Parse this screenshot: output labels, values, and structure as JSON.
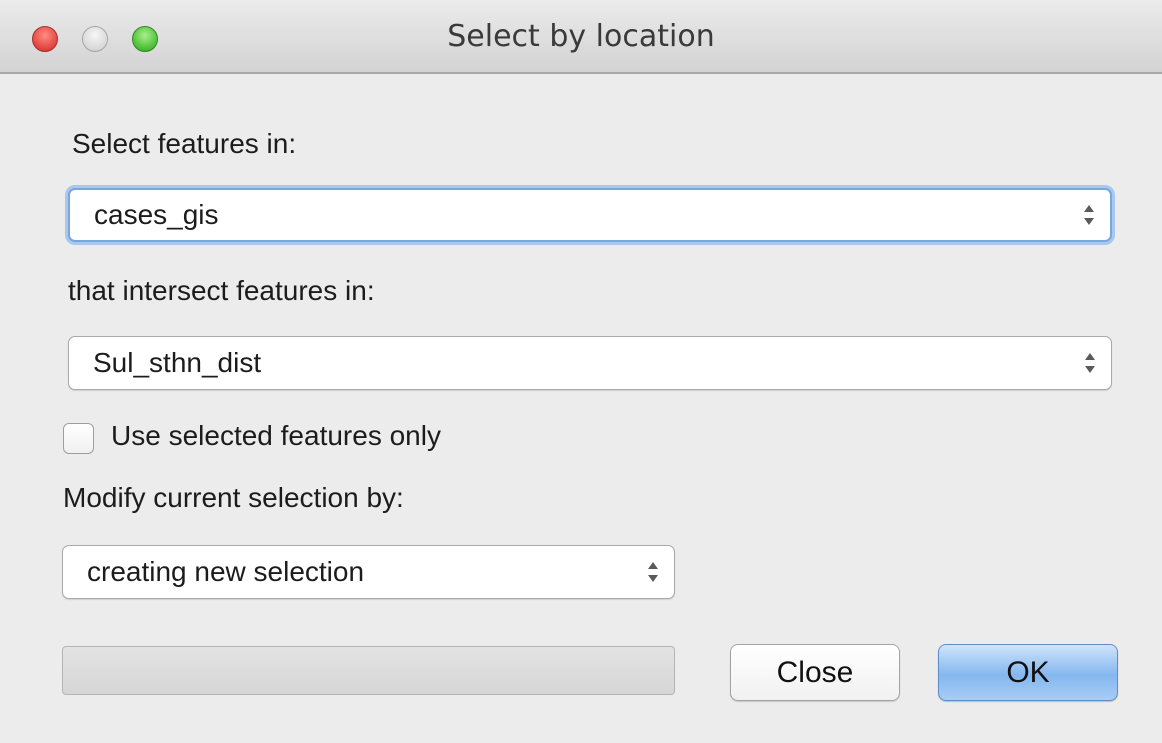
{
  "window": {
    "title": "Select by location"
  },
  "form": {
    "select_features_label": "Select features in:",
    "select_features_value": "cases_gis",
    "intersect_label": "that intersect features in:",
    "intersect_value": "Sul_sthn_dist",
    "use_selected_label": "Use selected features only",
    "use_selected_checked": false,
    "modify_label": "Modify current selection by:",
    "modify_value": "creating new selection",
    "progress_fraction": 0
  },
  "buttons": {
    "close_label": "Close",
    "ok_label": "OK"
  },
  "colors": {
    "close_light": "#e0443c",
    "minimize_light": "#d8d8d8",
    "zoom_light": "#4bbd33",
    "default_button": "#84b7ef",
    "focus_ring": "#a9c8ef"
  },
  "icons": {
    "close": "close-icon",
    "minimize": "minimize-icon",
    "zoom": "zoom-icon",
    "popup_arrows": "up-down-arrows-icon"
  }
}
